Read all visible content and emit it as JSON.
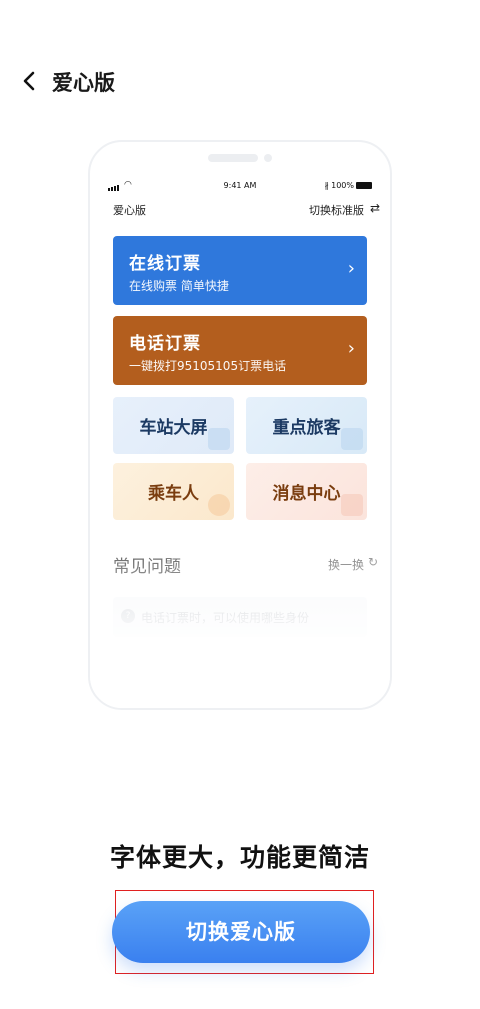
{
  "header": {
    "title": "爱心版"
  },
  "preview": {
    "status": {
      "time": "9:41 AM",
      "battery": "100%"
    },
    "title": "爱心版",
    "switch_label": "切换标准版",
    "cards": [
      {
        "title": "在线订票",
        "subtitle": "在线购票  简单快捷",
        "color": "#2f78dc"
      },
      {
        "title": "电话订票",
        "subtitle": "一键拨打95105105订票电话",
        "color": "#b35e1e"
      }
    ],
    "tiles": [
      {
        "label": "车站大屏"
      },
      {
        "label": "重点旅客"
      },
      {
        "label": "乘车人"
      },
      {
        "label": "消息中心"
      }
    ],
    "faq": {
      "title": "常见问题",
      "refresh_label": "换一换",
      "item_text": "电话订票时，可以使用哪些身份"
    }
  },
  "slogan": "字体更大，功能更简洁",
  "cta": {
    "label": "切换爱心版",
    "color": "#3a80ef"
  }
}
